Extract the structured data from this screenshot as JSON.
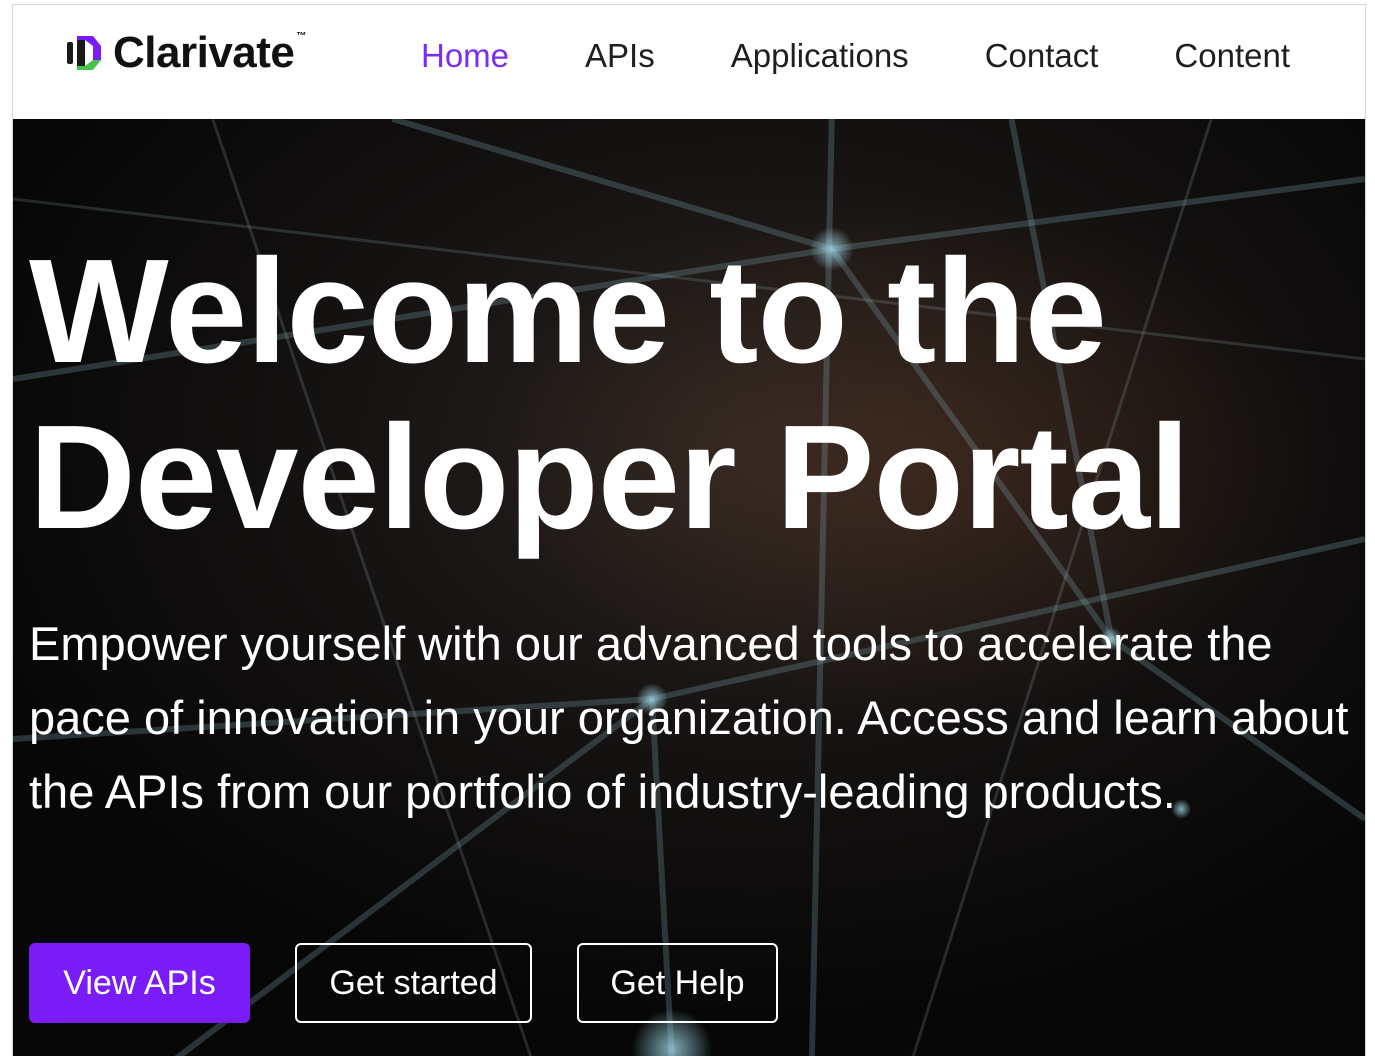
{
  "brand": {
    "name": "Clarivate",
    "trademark": "™",
    "colors": {
      "mark_dark": "#1a1a1a",
      "mark_green": "#46c44a",
      "mark_purple": "#7a1cf7"
    }
  },
  "nav": {
    "items": [
      {
        "label": "Home",
        "active": true
      },
      {
        "label": "APIs",
        "active": false
      },
      {
        "label": "Applications",
        "active": false
      },
      {
        "label": "Contact",
        "active": false
      },
      {
        "label": "Content",
        "active": false
      }
    ],
    "active_color": "#7b2cf5"
  },
  "hero": {
    "title": "Welcome to the Developer Portal",
    "subtitle": "Empower yourself with our advanced tools to accelerate the pace of innovation in your organization. Access and learn about the APIs from our portfolio of industry-leading products.",
    "background_color": "#0c0c0c",
    "buttons": {
      "primary": "View APIs",
      "secondary": "Get started",
      "tertiary": "Get Help"
    },
    "primary_color": "#7a1cf7"
  }
}
